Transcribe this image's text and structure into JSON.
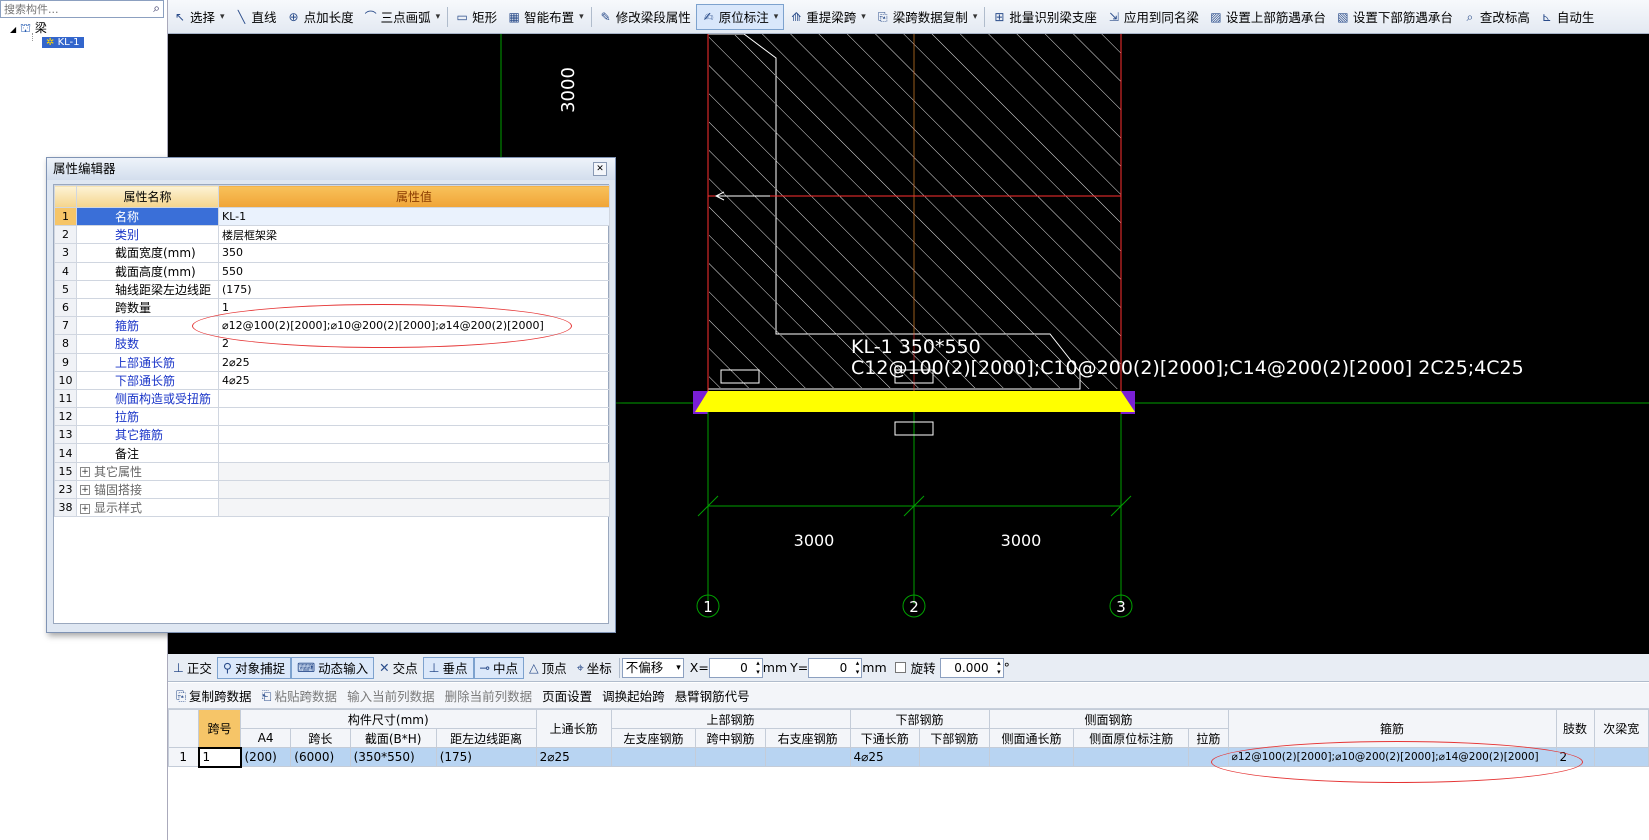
{
  "tree": {
    "search_placeholder": "搜索构件...",
    "root_label": "梁",
    "child_label": "KL-1"
  },
  "toolbar": {
    "items": [
      {
        "label": "选择",
        "icon": "cursor-icon",
        "glyph": "↖",
        "dropdown": true
      },
      {
        "label": "直线",
        "icon": "line-icon",
        "glyph": "╲"
      },
      {
        "label": "点加长度",
        "icon": "point-length-icon",
        "glyph": "⊕"
      },
      {
        "label": "三点画弧",
        "icon": "arc-icon",
        "glyph": "⌒",
        "dropdown": true
      },
      {
        "label": "矩形",
        "icon": "rectangle-icon",
        "glyph": "▭"
      },
      {
        "label": "智能布置",
        "icon": "smart-layout-icon",
        "glyph": "▦",
        "dropdown": true
      },
      {
        "label": "修改梁段属性",
        "icon": "edit-beam-icon",
        "glyph": "✎"
      },
      {
        "label": "原位标注",
        "icon": "in-place-annotation-icon",
        "glyph": "✍",
        "active": true,
        "dropdown": true
      },
      {
        "label": "重提梁跨",
        "icon": "re-extract-span-icon",
        "glyph": "⟰",
        "dropdown": true
      },
      {
        "label": "梁跨数据复制",
        "icon": "copy-span-data-icon",
        "glyph": "⎘",
        "dropdown": true
      },
      {
        "label": "批量识别梁支座",
        "icon": "batch-identify-icon",
        "glyph": "⊞"
      },
      {
        "label": "应用到同名梁",
        "icon": "apply-same-name-icon",
        "glyph": "⇲"
      },
      {
        "label": "设置上部筋遇承台",
        "icon": "set-top-rebar-icon",
        "glyph": "▨"
      },
      {
        "label": "设置下部筋遇承台",
        "icon": "set-bottom-rebar-icon",
        "glyph": "▧"
      },
      {
        "label": "查改标高",
        "icon": "elevation-icon",
        "glyph": "⌕"
      },
      {
        "label": "自动生",
        "icon": "auto-generate-icon",
        "glyph": "⊾"
      }
    ]
  },
  "canvas": {
    "dim_vertical": "3000",
    "beam_name_line": "KL-1 350*550",
    "beam_rebar_line": "C12@100(2)[2000];C10@200(2)[2000];C14@200(2)[2000] 2C25;4C25",
    "dim_span_left": "3000",
    "dim_span_right": "3000",
    "axis_labels": [
      "1",
      "2",
      "3"
    ],
    "colors": {
      "background": "#000000",
      "beam": "#ffff00",
      "grid": "#00a000",
      "axis_red": "#ff3030",
      "hatch": "#ffffff",
      "support": "#7a1fd6"
    }
  },
  "snapbar": {
    "items": [
      {
        "label": "正交",
        "icon": "orthogonal-icon",
        "glyph": "⊥"
      },
      {
        "label": "对象捕捉",
        "icon": "object-snap-icon",
        "glyph": "⚲",
        "on": true
      },
      {
        "label": "动态输入",
        "icon": "dynamic-input-icon",
        "glyph": "⌨",
        "on": true
      },
      {
        "label": "交点",
        "icon": "intersection-icon",
        "glyph": "✕"
      },
      {
        "label": "垂点",
        "icon": "perpendicular-icon",
        "glyph": "⊥",
        "on": true
      },
      {
        "label": "中点",
        "icon": "midpoint-icon",
        "glyph": "⊸",
        "on": true
      },
      {
        "label": "顶点",
        "icon": "vertex-icon",
        "glyph": "△"
      },
      {
        "label": "坐标",
        "icon": "coordinate-icon",
        "glyph": "⌖"
      }
    ],
    "offset_select": "不偏移",
    "x_label": "X=",
    "x_value": "0",
    "y_label": "Y=",
    "y_value": "0",
    "unit": "mm",
    "rotate_label": "旋转",
    "rotate_value": "0.000",
    "degree": "°"
  },
  "bottombar": {
    "items": [
      {
        "label": "复制跨数据",
        "icon": "copy-span-icon",
        "glyph": "⎘",
        "enabled": true
      },
      {
        "label": "粘贴跨数据",
        "icon": "paste-span-icon",
        "glyph": "⎗",
        "enabled": false
      },
      {
        "label": "输入当前列数据",
        "enabled": false
      },
      {
        "label": "删除当前列数据",
        "enabled": false
      },
      {
        "label": "页面设置",
        "enabled": true
      },
      {
        "label": "调换起始跨",
        "enabled": true
      },
      {
        "label": "悬臂钢筋代号",
        "enabled": true
      }
    ]
  },
  "span_table": {
    "group_headers": {
      "span_no": "跨号",
      "section": "构件尺寸(mm)",
      "top_through": "上通长筋",
      "top_rebar": "上部钢筋",
      "bottom_rebar": "下部钢筋",
      "side_rebar": "侧面钢筋",
      "stirrup": "箍筋",
      "legs": "肢数",
      "secondary": "次梁宽"
    },
    "sub_headers": [
      "A4",
      "跨长",
      "截面(B*H)",
      "距左边线距离",
      "左支座钢筋",
      "跨中钢筋",
      "右支座钢筋",
      "下通长筋",
      "下部钢筋",
      "侧面通长筋",
      "侧面原位标注筋",
      "拉筋"
    ],
    "rows": [
      {
        "row": "1",
        "span": "1",
        "a4": "(200)",
        "span_len": "(6000)",
        "section": "(350*550)",
        "offset": "(175)",
        "top_through": "2⌀25",
        "left_support": "",
        "mid": "",
        "right_support": "",
        "bottom_through": "4⌀25",
        "bottom": "",
        "side_through": "",
        "side_insitu": "",
        "tie": "",
        "stirrup": "⌀12@100(2)[2000];⌀10@200(2)[2000];⌀14@200(2)[2000]",
        "legs": "2",
        "secondary": ""
      }
    ]
  },
  "dialog": {
    "title": "属性编辑器",
    "col_name": "属性名称",
    "col_value": "属性值",
    "rows": [
      {
        "no": "1",
        "name": "名称",
        "value": "KL-1",
        "style": "sel"
      },
      {
        "no": "2",
        "name": "类别",
        "value": "楼层框架梁",
        "style": "blue"
      },
      {
        "no": "3",
        "name": "截面宽度(mm)",
        "value": "350",
        "style": "black"
      },
      {
        "no": "4",
        "name": "截面高度(mm)",
        "value": "550",
        "style": "black"
      },
      {
        "no": "5",
        "name": "轴线距梁左边线距",
        "value": "(175)",
        "style": "black"
      },
      {
        "no": "6",
        "name": "跨数量",
        "value": "1",
        "style": "black"
      },
      {
        "no": "7",
        "name": "箍筋",
        "value": "⌀12@100(2)[2000];⌀10@200(2)[2000];⌀14@200(2)[2000]",
        "style": "blue"
      },
      {
        "no": "8",
        "name": "肢数",
        "value": "2",
        "style": "blue"
      },
      {
        "no": "9",
        "name": "上部通长筋",
        "value": "2⌀25",
        "style": "blue"
      },
      {
        "no": "10",
        "name": "下部通长筋",
        "value": "4⌀25",
        "style": "blue"
      },
      {
        "no": "11",
        "name": "侧面构造或受扭筋",
        "value": "",
        "style": "blue"
      },
      {
        "no": "12",
        "name": "拉筋",
        "value": "",
        "style": "blue"
      },
      {
        "no": "13",
        "name": "其它箍筋",
        "value": "",
        "style": "blue"
      },
      {
        "no": "14",
        "name": "备注",
        "value": "",
        "style": "black"
      },
      {
        "no": "15",
        "name": "其它属性",
        "value": "",
        "style": "group"
      },
      {
        "no": "23",
        "name": "锚固搭接",
        "value": "",
        "style": "group"
      },
      {
        "no": "38",
        "name": "显示样式",
        "value": "",
        "style": "group"
      }
    ]
  }
}
